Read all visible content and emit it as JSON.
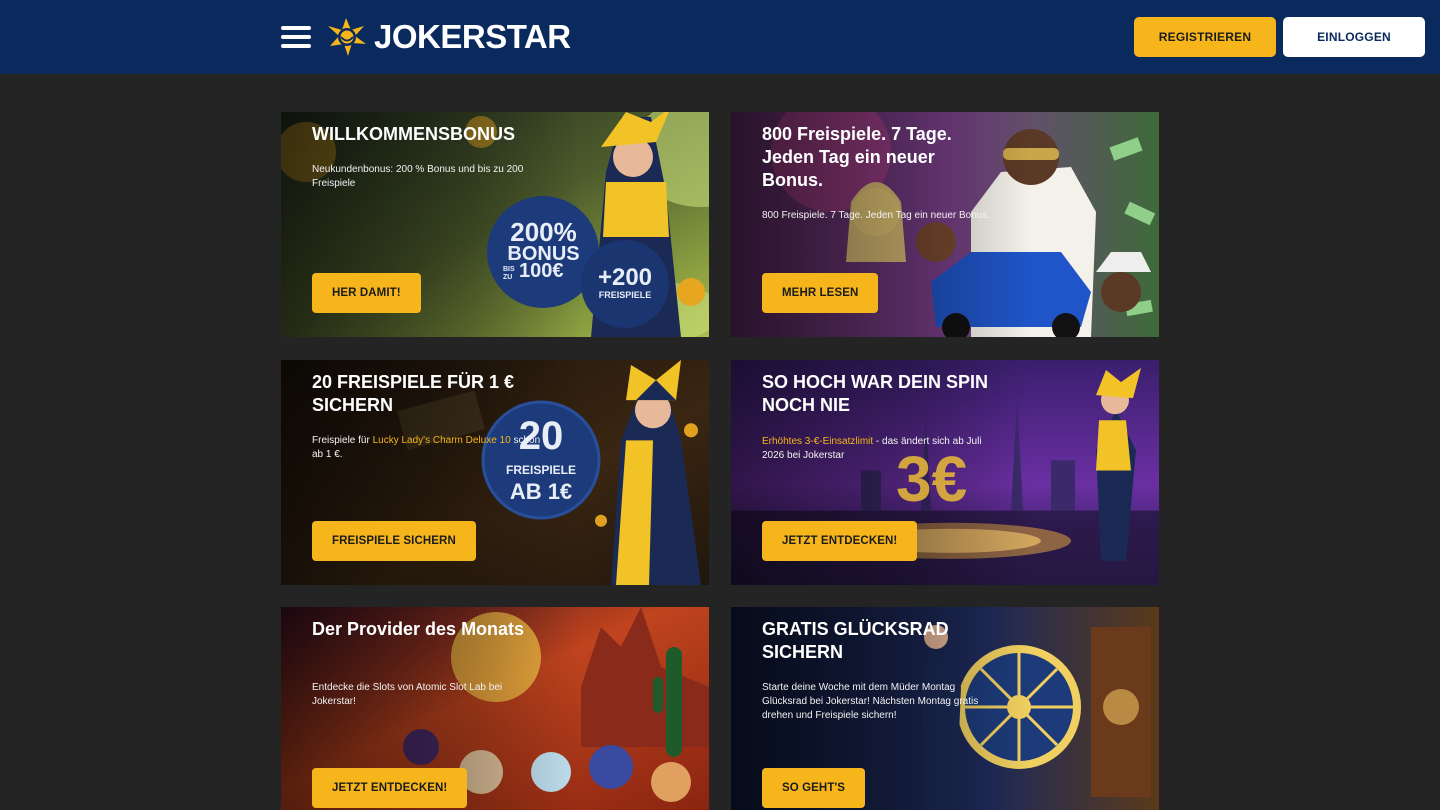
{
  "header": {
    "brand": "JOKERSTAR",
    "register_label": "REGISTRIEREN",
    "login_label": "EINLOGGEN"
  },
  "colors": {
    "header_bg": "#0a2a5e",
    "accent": "#f6b51b",
    "page_bg": "#242424"
  },
  "promos": [
    {
      "title": "WILLKOMMENSBONUS",
      "text": "Neukundenbonus: 200 % Bonus und bis zu 200 Freispiele",
      "cta": "HER DAMIT!",
      "badge_main": "200%",
      "badge_bonus": "BONUS",
      "badge_bis": "BIS ZU",
      "badge_amount": "100€",
      "badge2_main": "+200",
      "badge2_sub": "FREISPIELE"
    },
    {
      "title": "800 Freispiele. 7 Tage. Jeden Tag ein neuer Bonus.",
      "text": "800 Freispiele. 7 Tage. Jeden Tag ein neuer Bonus.",
      "cta": "MEHR LESEN"
    },
    {
      "title": "20 FREISPIELE FÜR 1 € SICHERN",
      "text_before": "Freispiele für ",
      "text_highlight": "Lucky Lady's Charm Deluxe 10",
      "text_after": " schon ab 1 €.",
      "cta": "FREISPIELE SICHERN",
      "badge_main": "20",
      "badge_sub": "FREISPIELE",
      "badge_ab": "AB 1€"
    },
    {
      "title": "SO HOCH WAR DEIN SPIN NOCH NIE",
      "text_highlight": "Erhöhtes 3-€-Einsatzlimit",
      "text_after": " - das ändert sich ab Juli 2026 bei Jokerstar",
      "cta": "JETZT ENTDECKEN!",
      "big_figure": "3€"
    },
    {
      "title": "Der Provider des Monats",
      "text": "Entdecke die Slots von Atomic Slot Lab bei Jokerstar!",
      "cta": "JETZT ENTDECKEN!"
    },
    {
      "title": "GRATIS GLÜCKSRAD SICHERN",
      "text": "Starte deine Woche mit dem Müder Montag Glücksrad bei Jokerstar! Nächsten Montag gratis drehen und Freispiele sichern!",
      "cta": "SO GEHT'S"
    }
  ]
}
